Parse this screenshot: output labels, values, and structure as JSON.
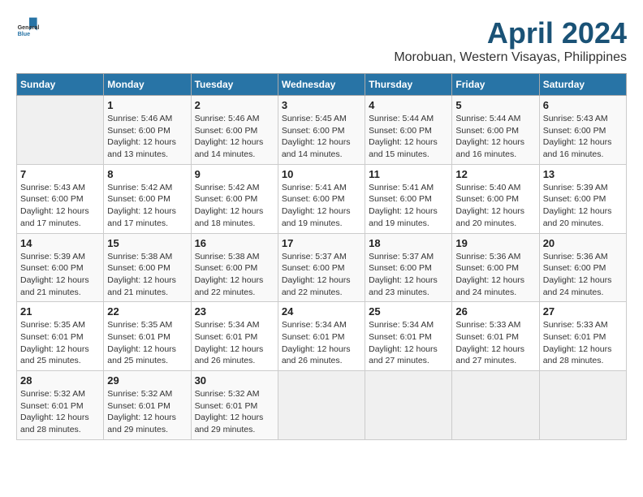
{
  "header": {
    "logo_general": "General",
    "logo_blue": "Blue",
    "month_year": "April 2024",
    "location": "Morobuan, Western Visayas, Philippines"
  },
  "days_of_week": [
    "Sunday",
    "Monday",
    "Tuesday",
    "Wednesday",
    "Thursday",
    "Friday",
    "Saturday"
  ],
  "weeks": [
    [
      {
        "day": "",
        "info": ""
      },
      {
        "day": "1",
        "info": "Sunrise: 5:46 AM\nSunset: 6:00 PM\nDaylight: 12 hours\nand 13 minutes."
      },
      {
        "day": "2",
        "info": "Sunrise: 5:46 AM\nSunset: 6:00 PM\nDaylight: 12 hours\nand 14 minutes."
      },
      {
        "day": "3",
        "info": "Sunrise: 5:45 AM\nSunset: 6:00 PM\nDaylight: 12 hours\nand 14 minutes."
      },
      {
        "day": "4",
        "info": "Sunrise: 5:44 AM\nSunset: 6:00 PM\nDaylight: 12 hours\nand 15 minutes."
      },
      {
        "day": "5",
        "info": "Sunrise: 5:44 AM\nSunset: 6:00 PM\nDaylight: 12 hours\nand 16 minutes."
      },
      {
        "day": "6",
        "info": "Sunrise: 5:43 AM\nSunset: 6:00 PM\nDaylight: 12 hours\nand 16 minutes."
      }
    ],
    [
      {
        "day": "7",
        "info": "Sunrise: 5:43 AM\nSunset: 6:00 PM\nDaylight: 12 hours\nand 17 minutes."
      },
      {
        "day": "8",
        "info": "Sunrise: 5:42 AM\nSunset: 6:00 PM\nDaylight: 12 hours\nand 17 minutes."
      },
      {
        "day": "9",
        "info": "Sunrise: 5:42 AM\nSunset: 6:00 PM\nDaylight: 12 hours\nand 18 minutes."
      },
      {
        "day": "10",
        "info": "Sunrise: 5:41 AM\nSunset: 6:00 PM\nDaylight: 12 hours\nand 19 minutes."
      },
      {
        "day": "11",
        "info": "Sunrise: 5:41 AM\nSunset: 6:00 PM\nDaylight: 12 hours\nand 19 minutes."
      },
      {
        "day": "12",
        "info": "Sunrise: 5:40 AM\nSunset: 6:00 PM\nDaylight: 12 hours\nand 20 minutes."
      },
      {
        "day": "13",
        "info": "Sunrise: 5:39 AM\nSunset: 6:00 PM\nDaylight: 12 hours\nand 20 minutes."
      }
    ],
    [
      {
        "day": "14",
        "info": "Sunrise: 5:39 AM\nSunset: 6:00 PM\nDaylight: 12 hours\nand 21 minutes."
      },
      {
        "day": "15",
        "info": "Sunrise: 5:38 AM\nSunset: 6:00 PM\nDaylight: 12 hours\nand 21 minutes."
      },
      {
        "day": "16",
        "info": "Sunrise: 5:38 AM\nSunset: 6:00 PM\nDaylight: 12 hours\nand 22 minutes."
      },
      {
        "day": "17",
        "info": "Sunrise: 5:37 AM\nSunset: 6:00 PM\nDaylight: 12 hours\nand 22 minutes."
      },
      {
        "day": "18",
        "info": "Sunrise: 5:37 AM\nSunset: 6:00 PM\nDaylight: 12 hours\nand 23 minutes."
      },
      {
        "day": "19",
        "info": "Sunrise: 5:36 AM\nSunset: 6:00 PM\nDaylight: 12 hours\nand 24 minutes."
      },
      {
        "day": "20",
        "info": "Sunrise: 5:36 AM\nSunset: 6:00 PM\nDaylight: 12 hours\nand 24 minutes."
      }
    ],
    [
      {
        "day": "21",
        "info": "Sunrise: 5:35 AM\nSunset: 6:01 PM\nDaylight: 12 hours\nand 25 minutes."
      },
      {
        "day": "22",
        "info": "Sunrise: 5:35 AM\nSunset: 6:01 PM\nDaylight: 12 hours\nand 25 minutes."
      },
      {
        "day": "23",
        "info": "Sunrise: 5:34 AM\nSunset: 6:01 PM\nDaylight: 12 hours\nand 26 minutes."
      },
      {
        "day": "24",
        "info": "Sunrise: 5:34 AM\nSunset: 6:01 PM\nDaylight: 12 hours\nand 26 minutes."
      },
      {
        "day": "25",
        "info": "Sunrise: 5:34 AM\nSunset: 6:01 PM\nDaylight: 12 hours\nand 27 minutes."
      },
      {
        "day": "26",
        "info": "Sunrise: 5:33 AM\nSunset: 6:01 PM\nDaylight: 12 hours\nand 27 minutes."
      },
      {
        "day": "27",
        "info": "Sunrise: 5:33 AM\nSunset: 6:01 PM\nDaylight: 12 hours\nand 28 minutes."
      }
    ],
    [
      {
        "day": "28",
        "info": "Sunrise: 5:32 AM\nSunset: 6:01 PM\nDaylight: 12 hours\nand 28 minutes."
      },
      {
        "day": "29",
        "info": "Sunrise: 5:32 AM\nSunset: 6:01 PM\nDaylight: 12 hours\nand 29 minutes."
      },
      {
        "day": "30",
        "info": "Sunrise: 5:32 AM\nSunset: 6:01 PM\nDaylight: 12 hours\nand 29 minutes."
      },
      {
        "day": "",
        "info": ""
      },
      {
        "day": "",
        "info": ""
      },
      {
        "day": "",
        "info": ""
      },
      {
        "day": "",
        "info": ""
      }
    ]
  ]
}
